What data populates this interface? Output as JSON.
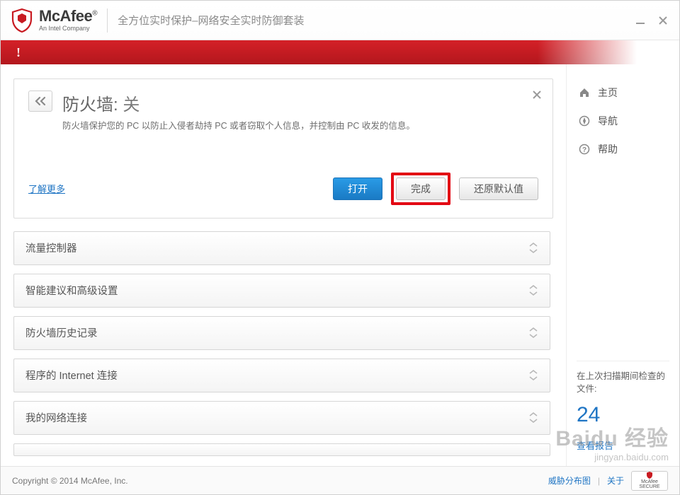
{
  "header": {
    "brand_name": "McAfee",
    "brand_reg": "®",
    "brand_sub": "An Intel Company",
    "subtitle": "全方位实时保护–网络安全实时防御套装"
  },
  "redbar": {
    "glyph": "!"
  },
  "card": {
    "title_main": "防火墙",
    "title_sep": ": ",
    "title_status": "关",
    "description": "防火墙保护您的 PC 以防止入侵者劫持 PC 或者窃取个人信息，并控制由 PC 收发的信息。",
    "learn_more": "了解更多",
    "btn_open": "打开",
    "btn_done": "完成",
    "btn_restore": "还原默认值"
  },
  "panels": [
    {
      "label": "流量控制器"
    },
    {
      "label": "智能建议和高级设置"
    },
    {
      "label": "防火墙历史记录"
    },
    {
      "label": "程序的 Internet 连接"
    },
    {
      "label": "我的网络连接"
    }
  ],
  "sidebar": {
    "items": [
      {
        "label": "主页"
      },
      {
        "label": "导航"
      },
      {
        "label": "帮助"
      }
    ],
    "stat_label": "在上次扫描期间检查的文件:",
    "stat_value": "24",
    "report_link": "查看报告"
  },
  "footer": {
    "copyright": "Copyright © 2014 McAfee, Inc.",
    "link_threat": "威胁分布图",
    "link_about": "关于",
    "secure_badge": "McAfee SECURE"
  },
  "watermark": {
    "main": "Baidu 经验",
    "sub": "jingyan.baidu.com"
  }
}
